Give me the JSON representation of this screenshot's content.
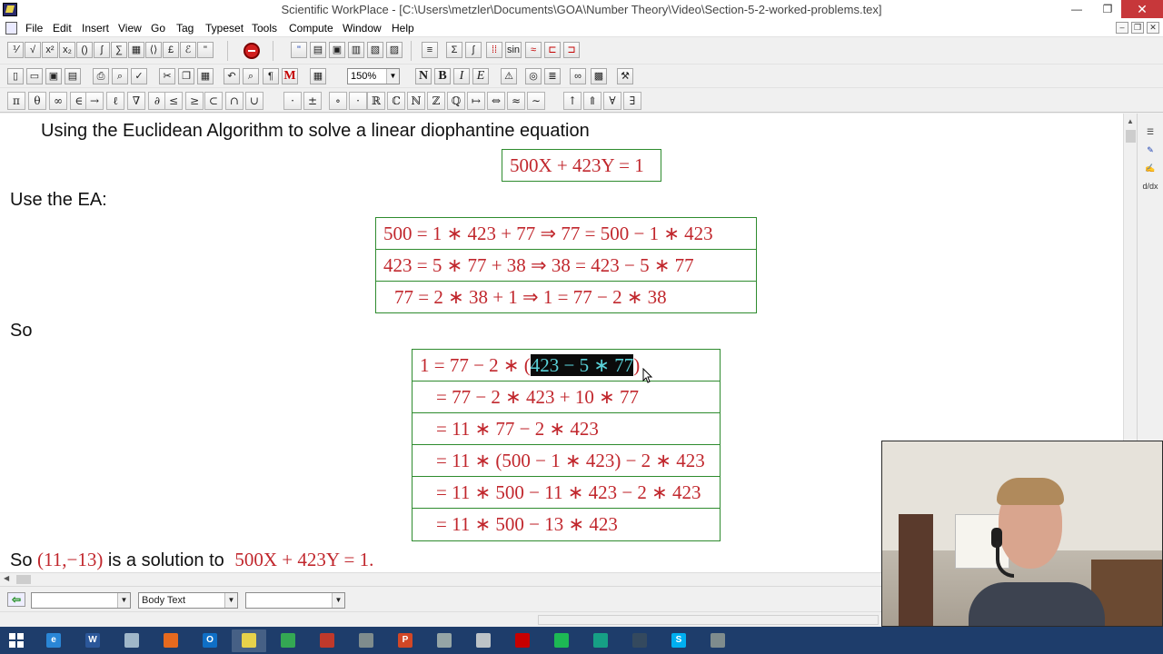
{
  "window": {
    "title": "Scientific WorkPlace - [C:\\Users\\metzler\\Documents\\GOA\\Number Theory\\Video\\Section-5-2-worked-problems.tex]",
    "minimize": "—",
    "maximize": "❐",
    "close": "✕"
  },
  "menu": {
    "items": [
      "File",
      "Edit",
      "Insert",
      "View",
      "Go",
      "Tag",
      "Typeset",
      "Tools",
      "Compute",
      "Window",
      "Help"
    ],
    "mdi": [
      "–",
      "❐",
      "✕"
    ]
  },
  "toolbar": {
    "zoom": "150%",
    "format_buttons": [
      "N",
      "B",
      "I",
      "E"
    ],
    "math_symbols": [
      "π",
      "θ",
      "∞",
      "∈",
      "→",
      "ℓ",
      "∇",
      "∂",
      "≤",
      "≥",
      "⊂",
      "∩",
      "∪",
      "·",
      "±",
      "∘",
      "·",
      "ℝ",
      "ℂ",
      "ℕ",
      "ℤ",
      "ℚ",
      "↦",
      "⇔",
      "≈",
      "∼",
      "↑",
      "⇑",
      "∀",
      "∃"
    ]
  },
  "document": {
    "heading": "Using the Euclidean Algorithm to solve a linear diophantine equation",
    "equation": "500X + 423Y = 1",
    "use_ea_label": "Use the EA:",
    "ea_rows": [
      "500 = 1 ∗ 423 + 77  ⇒  77 = 500 − 1 ∗ 423",
      "423 = 5 ∗ 77 + 38  ⇒ 38  = 423 − 5 ∗ 77",
      "77 = 2 ∗ 38 + 1  ⇒  1 = 77 − 2 ∗ 38"
    ],
    "so_label": "So",
    "back_sub": {
      "first_prefix": "1 = 77 − 2 ∗ (",
      "first_selected": "423 − 5 ∗ 77",
      "first_suffix": ")",
      "rows": [
        "= 77 − 2 ∗ 423 + 10 ∗ 77",
        "= 11 ∗ 77 − 2 ∗ 423",
        "= 11 ∗ (500 − 1 ∗ 423) − 2 ∗ 423",
        "= 11 ∗ 500 − 11 ∗ 423 − 2 ∗ 423",
        "= 11 ∗ 500 − 13 ∗ 423"
      ]
    },
    "conclusion": {
      "lead": "So",
      "solution": "(11,−13)",
      "middle": "is a solution to",
      "equation": "500X + 423Y = 1.",
      "trailing": ""
    }
  },
  "statusbar": {
    "back_glyph": "⇦",
    "combo1": "",
    "combo2": "Body Text",
    "combo3": ""
  },
  "colors": {
    "math_red": "#c1272d",
    "box_green": "#2e8b2e",
    "selection_bg": "#0b0b0b",
    "selection_fg": "#59d2d9",
    "taskbar": "#1e3d6b",
    "close_red": "#c7373a"
  },
  "taskbar": {
    "apps": [
      {
        "icon": "ie-icon",
        "label": "e",
        "color": "#2a86d6"
      },
      {
        "icon": "word-icon",
        "label": "W",
        "color": "#2b579a"
      },
      {
        "icon": "notepad-icon",
        "label": "",
        "color": "#9fb7c9"
      },
      {
        "icon": "firefox-icon",
        "label": "",
        "color": "#e66a1f"
      },
      {
        "icon": "outlook-icon",
        "label": "O",
        "color": "#0f6fc6"
      },
      {
        "icon": "swp-icon",
        "label": "",
        "color": "#e8d24a"
      },
      {
        "icon": "chrome-icon",
        "label": "",
        "color": "#34a853"
      },
      {
        "icon": "app-icon-1",
        "label": "",
        "color": "#c0392b"
      },
      {
        "icon": "app-icon-2",
        "label": "",
        "color": "#7f8c8d"
      },
      {
        "icon": "powerpoint-icon",
        "label": "P",
        "color": "#d24726"
      },
      {
        "icon": "app-icon-3",
        "label": "",
        "color": "#95a5a6"
      },
      {
        "icon": "app-icon-4",
        "label": "",
        "color": "#bdc3c7"
      },
      {
        "icon": "acrobat-icon",
        "label": "",
        "color": "#c70000"
      },
      {
        "icon": "spotify-icon",
        "label": "",
        "color": "#1db954"
      },
      {
        "icon": "app-icon-5",
        "label": "",
        "color": "#16a085"
      },
      {
        "icon": "app-icon-6",
        "label": "",
        "color": "#34495e"
      },
      {
        "icon": "skype-icon",
        "label": "S",
        "color": "#00aff0"
      },
      {
        "icon": "app-icon-7",
        "label": "",
        "color": "#7f8c8d"
      }
    ]
  }
}
